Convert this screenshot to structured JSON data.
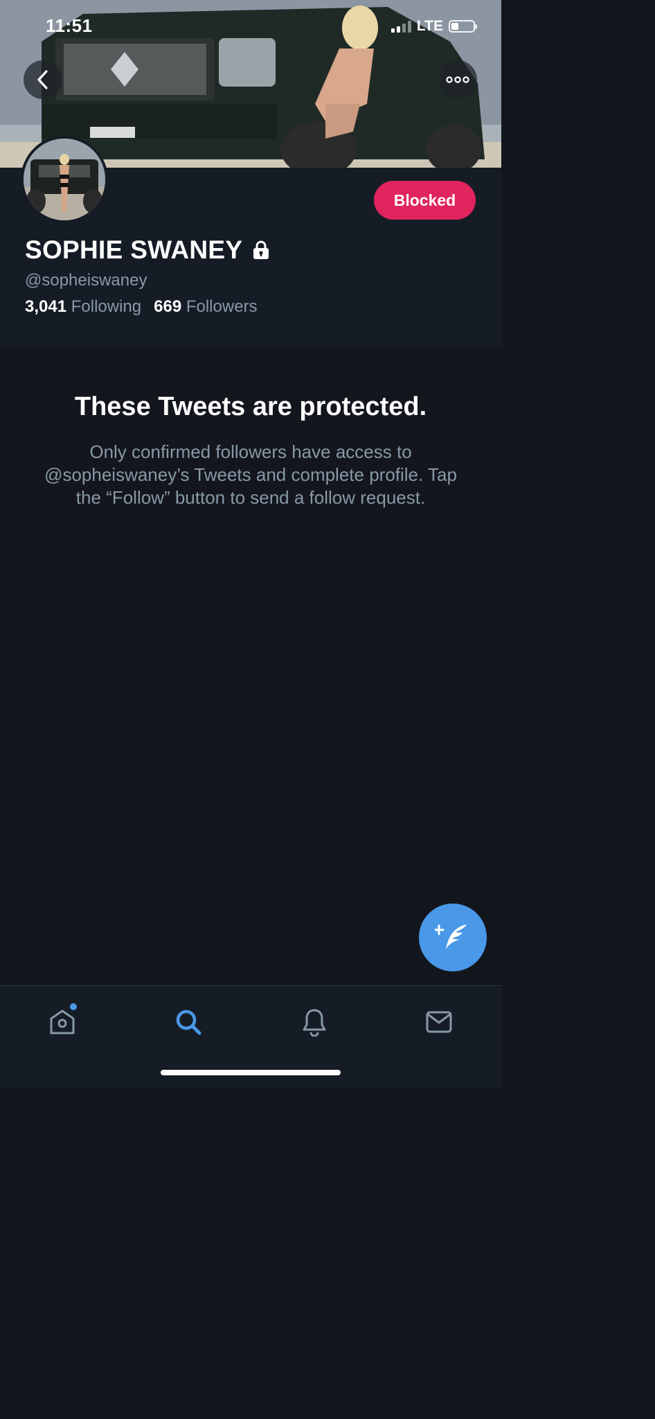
{
  "status_bar": {
    "time": "11:51",
    "network": "LTE"
  },
  "profile": {
    "name": "SOPHIE SWANEY",
    "handle": "@sopheiswaney",
    "following_count": "3,041",
    "following_label": "Following",
    "followers_count": "669",
    "followers_label": "Followers",
    "blocked_label": "Blocked"
  },
  "protected": {
    "title": "These Tweets are protected.",
    "body": "Only confirmed followers have access to @sopheiswaney’s Tweets and complete profile. Tap the “Follow” button to send a follow request."
  },
  "colors": {
    "accent": "#4a99e9",
    "blocked": "#e0245e",
    "background": "#13161d",
    "secondary_text": "#8899a6"
  },
  "icons": [
    "back-icon",
    "more-icon",
    "lock-icon",
    "compose-tweet-icon",
    "home-icon",
    "search-icon",
    "notifications-icon",
    "messages-icon"
  ],
  "tabs": {
    "active": "search"
  }
}
